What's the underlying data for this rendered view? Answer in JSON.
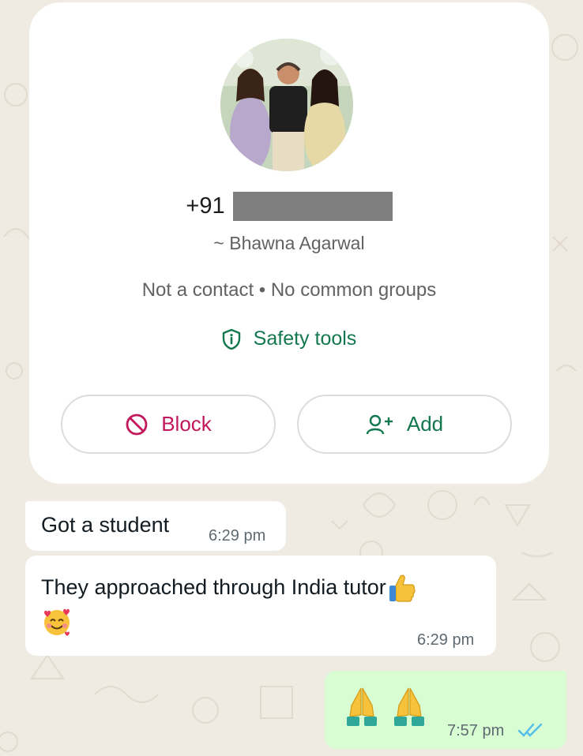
{
  "profile_card": {
    "phone_prefix": "+91",
    "push_name": "~ Bhawna Agarwal",
    "status_line": "Not a contact • No common groups",
    "safety_tools_label": "Safety tools",
    "block_label": "Block",
    "add_label": "Add"
  },
  "messages": [
    {
      "direction": "incoming",
      "text": "Got a student",
      "time": "6:29 pm"
    },
    {
      "direction": "incoming",
      "text": "They approached through India tutor",
      "emojis": [
        "thumbs-up",
        "smiling-face-with-hearts"
      ],
      "time": "6:29 pm"
    },
    {
      "direction": "outgoing",
      "emojis": [
        "folded-hands",
        "folded-hands"
      ],
      "time": "7:57 pm",
      "read_status": "read"
    }
  ],
  "colors": {
    "background": "#efeae2",
    "accent_green": "#137850",
    "block_red": "#c2185b",
    "outgoing_bubble": "#d9fdd3",
    "read_ticks": "#53bdeb"
  }
}
